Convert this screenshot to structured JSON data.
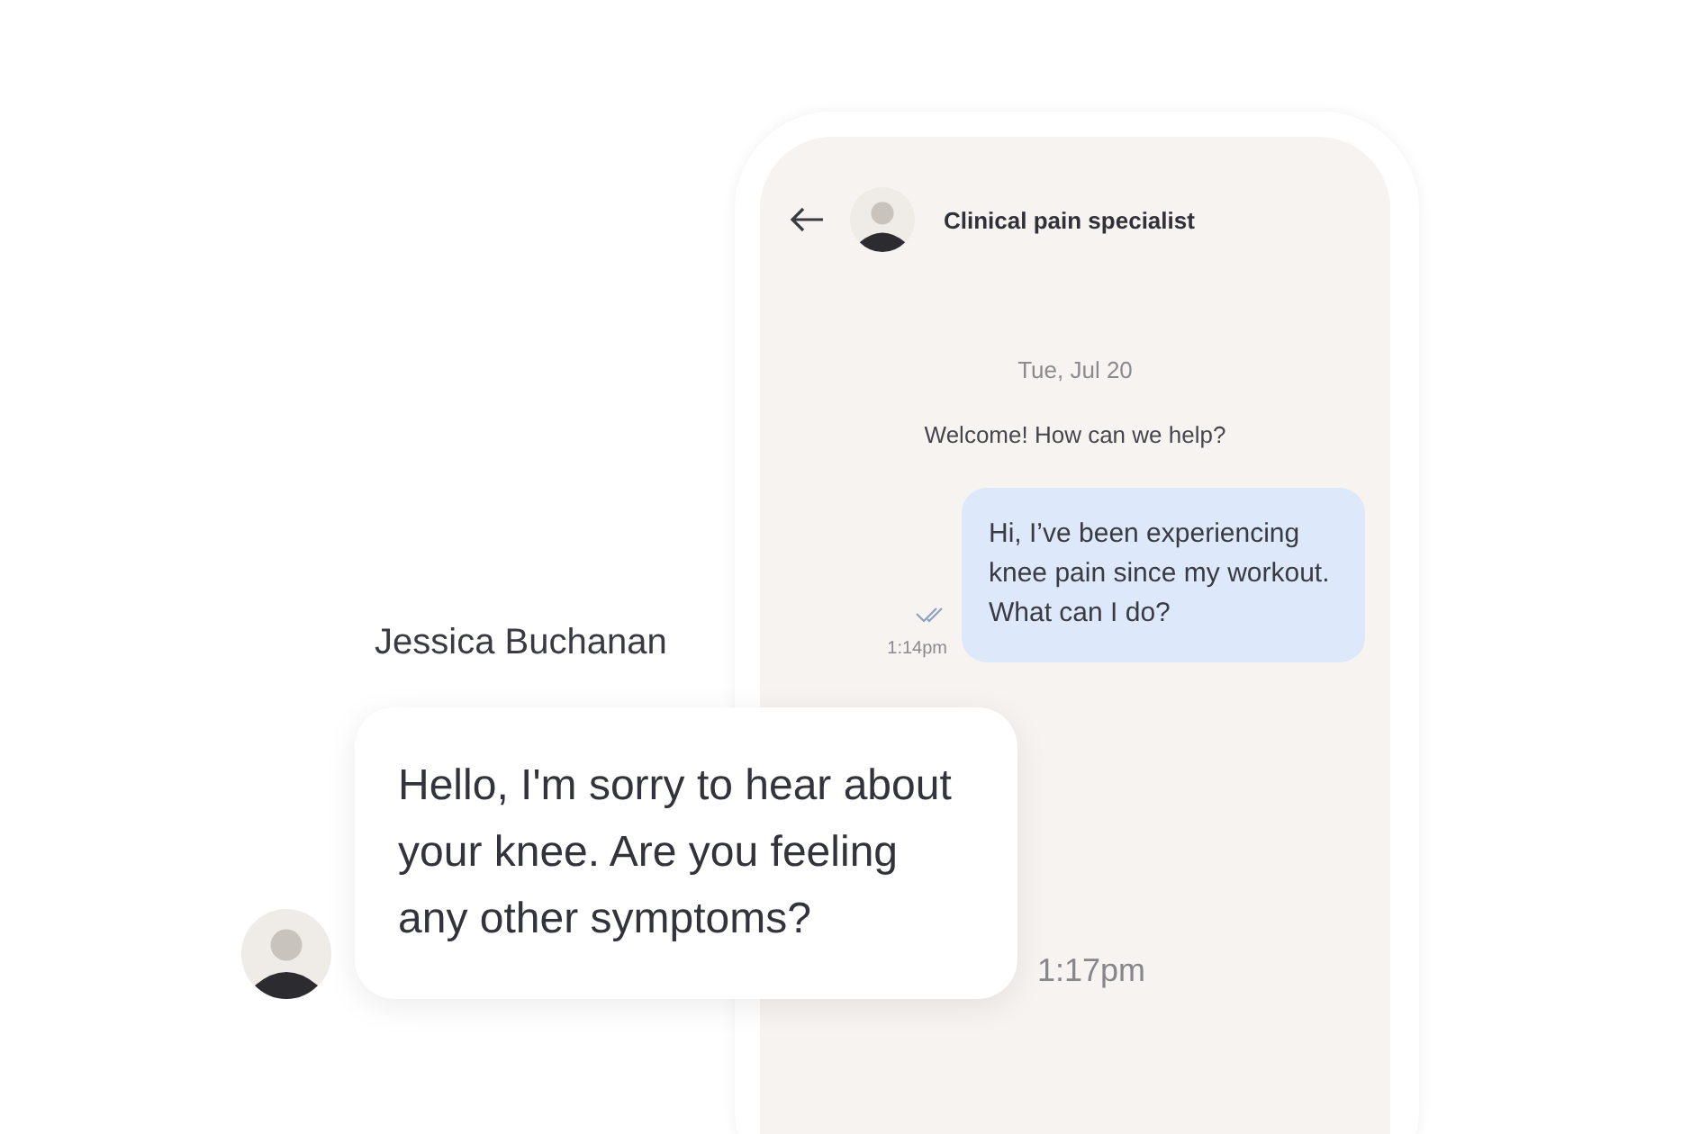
{
  "chat": {
    "header": {
      "title": "Clinical pain specialist"
    },
    "date": "Tue, Jul 20",
    "welcome": "Welcome! How can we help?",
    "messages": [
      {
        "kind": "outgoing",
        "text": "Hi, I’ve been experiencing knee pain since my workout. What can I do?",
        "time": "1:14pm",
        "read": true
      }
    ]
  },
  "reply": {
    "sender": "Jessica Buchanan",
    "text": "Hello, I'm sorry to hear about your knee. Are you feeling any other symptoms?",
    "time": "1:17pm"
  }
}
